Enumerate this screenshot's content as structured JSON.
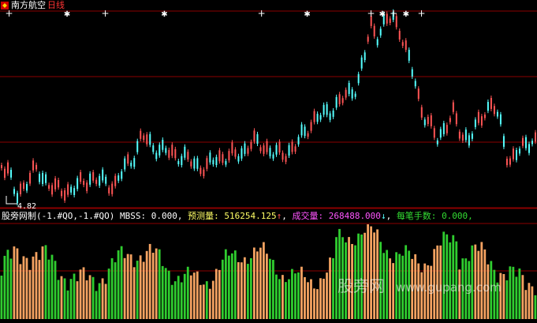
{
  "title": {
    "stock_name": "南方航空",
    "period": "日线"
  },
  "colors": {
    "up": "#ff5555",
    "down": "#55ffff",
    "grid": "#8b0000",
    "vol_green": "#2fcc2f",
    "vol_orange": "#f4a261",
    "white": "#ffffff",
    "yellow": "#ffff66",
    "magenta": "#ff55ff",
    "green_text": "#33dd33"
  },
  "price_panel": {
    "low_label": "4.82",
    "marker_x_fractions": [
      0.017,
      0.125,
      0.196,
      0.306,
      0.487,
      0.572,
      0.691,
      0.712,
      0.733,
      0.756,
      0.785
    ]
  },
  "indicator": {
    "name": "股旁网制",
    "params": "(-1.#QO,-1.#QO)",
    "mbss_label": "MBSS:",
    "mbss_value": "0.000,",
    "forecast_label": "预测量:",
    "forecast_value": "516254.125",
    "forecast_arrow": "↑",
    "volume_label": "成交量:",
    "volume_value": "268488.000",
    "volume_arrow": "↓",
    "per_trade_label": "每笔手数:",
    "per_trade_value": "0.000,"
  },
  "watermark": {
    "cn": "股旁网",
    "url": "www.gupang.com"
  }
}
